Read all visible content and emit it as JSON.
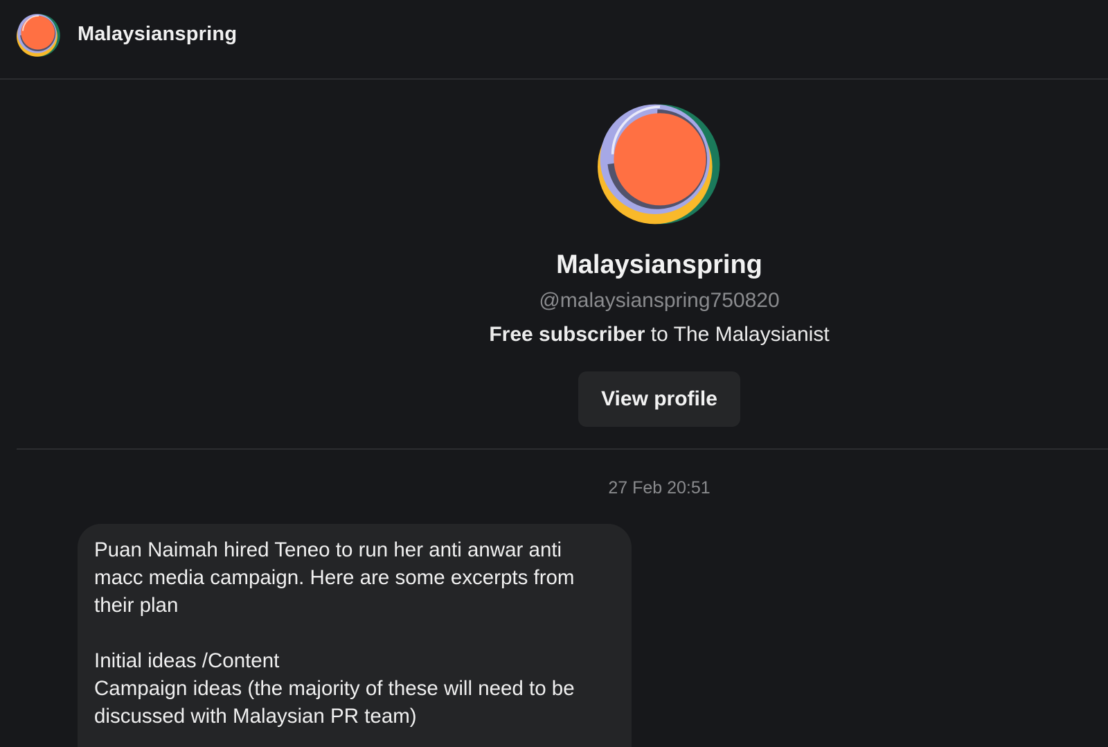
{
  "header": {
    "avatar_icon": "profile-avatar-icon",
    "name": "Malaysianspring"
  },
  "profile": {
    "avatar_icon": "profile-avatar-icon",
    "name": "Malaysianspring",
    "handle": "@malaysianspring750820",
    "subscription_type": "Free subscriber",
    "subscription_connector": " to ",
    "publication": "The Malaysianist",
    "view_profile_label": "View profile"
  },
  "messages": [
    {
      "timestamp": "27 Feb 20:51",
      "lines": [
        "Puan Naimah hired Teneo to run her anti anwar anti",
        "macc media campaign. Here are some excerpts from",
        "their plan",
        "",
        "Initial ideas /Content",
        "Campaign ideas (the majority of these will need to be",
        "discussed with Malaysian PR team)"
      ]
    }
  ],
  "colors": {
    "background": "#17181b",
    "divider": "#2c2d30",
    "bubble": "#242527",
    "button": "#252628",
    "muted_text": "#8a8b8e",
    "avatar_orange": "#ff7043",
    "avatar_yellow": "#f9b92a",
    "avatar_green": "#1b7a5b",
    "avatar_lavender": "#a6a8e6"
  }
}
